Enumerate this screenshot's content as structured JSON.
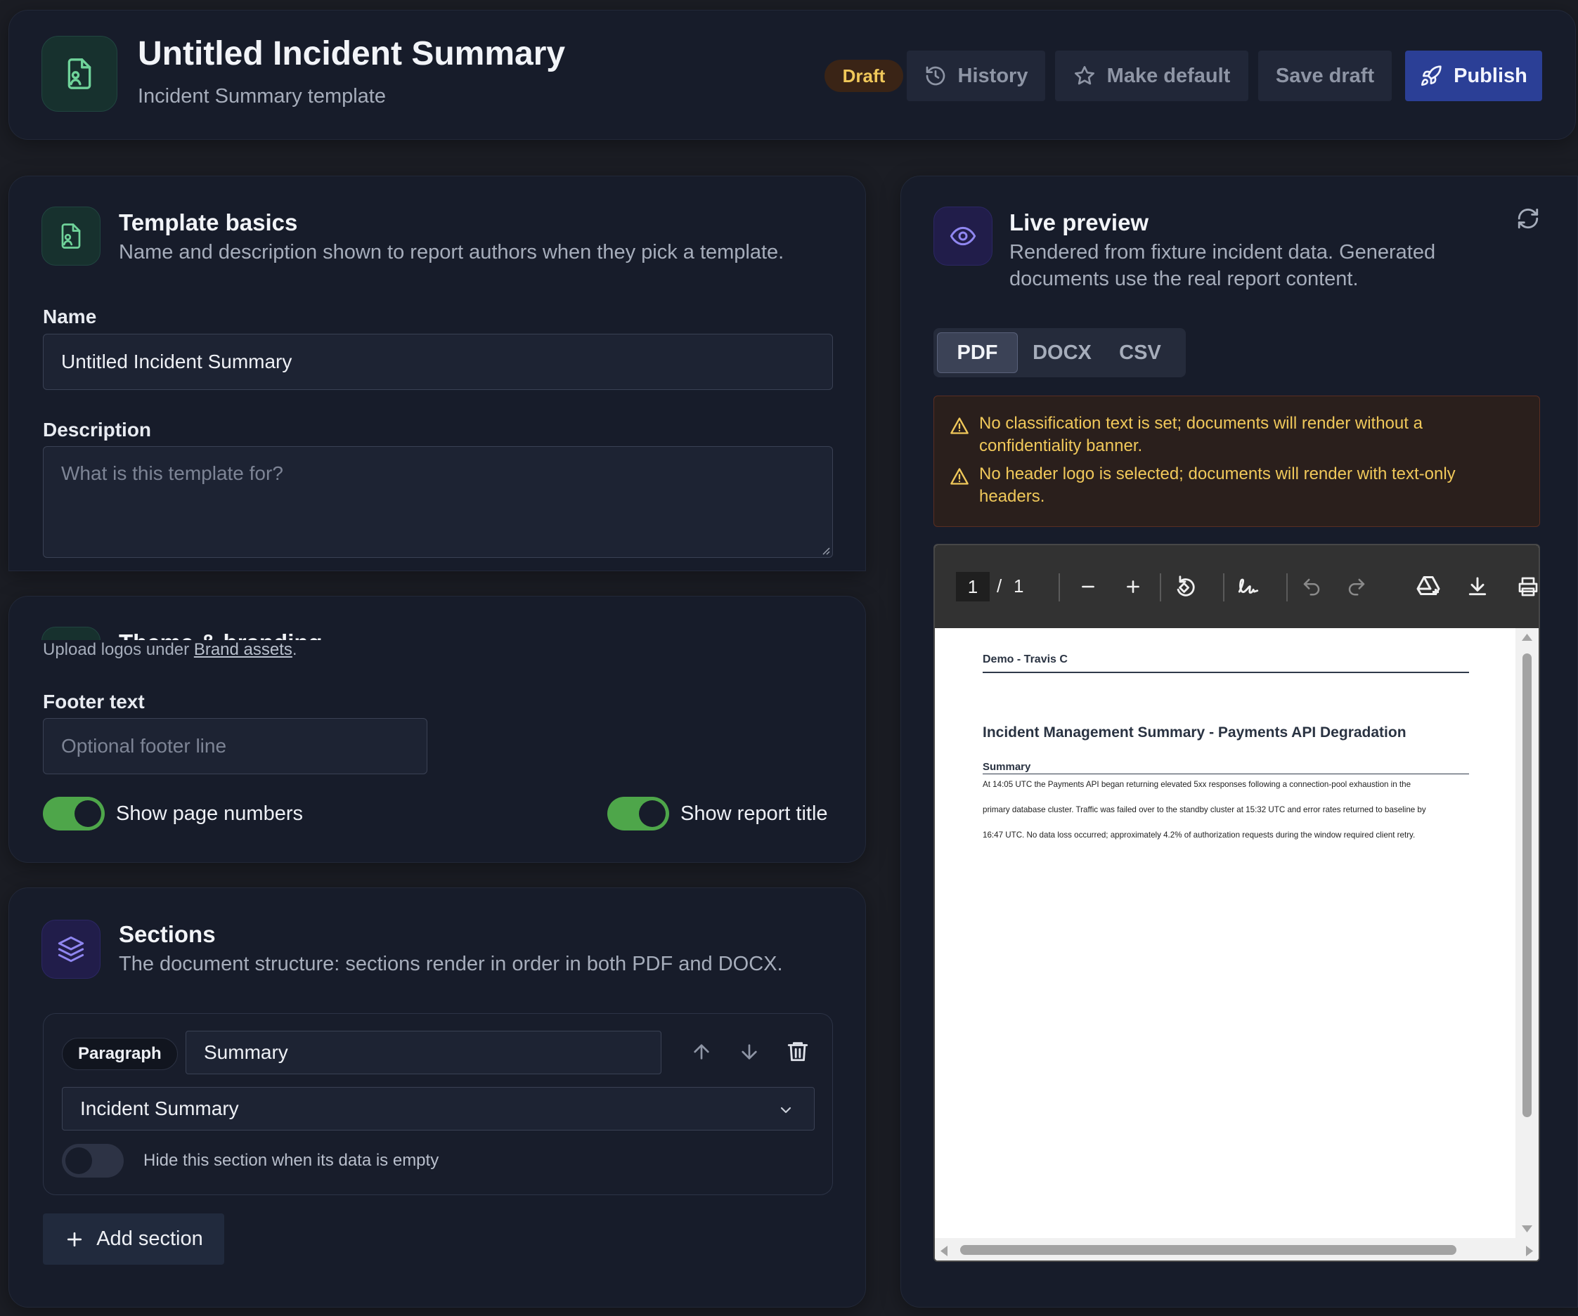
{
  "header": {
    "title": "Untitled Incident Summary",
    "subtitle": "Incident Summary template",
    "status_badge": "Draft",
    "history_label": "History",
    "make_default_label": "Make default",
    "save_draft_label": "Save draft",
    "publish_label": "Publish"
  },
  "basics": {
    "title": "Template basics",
    "description": "Name and description shown to report authors when they pick a template.",
    "name_label": "Name",
    "name_value": "Untitled Incident Summary",
    "description_label": "Description",
    "description_placeholder": "What is this template for?"
  },
  "theme": {
    "title": "Theme & branding",
    "upload_note_prefix": "Upload logos under ",
    "upload_note_link": "Brand assets",
    "upload_note_suffix": ".",
    "footer_label": "Footer text",
    "footer_placeholder": "Optional footer line",
    "show_page_numbers_label": "Show page numbers",
    "show_page_numbers": true,
    "show_report_title_label": "Show report title",
    "show_report_title": true
  },
  "sections": {
    "title": "Sections",
    "description": "The document structure: sections render in order in both PDF and DOCX.",
    "items": [
      {
        "type_badge": "Paragraph",
        "name": "Summary",
        "source": "Incident Summary",
        "hide_when_empty_label": "Hide this section when its data is empty",
        "hide_when_empty": false
      }
    ],
    "add_label": "Add section"
  },
  "preview": {
    "title": "Live preview",
    "description_line1": "Rendered from fixture incident data. Generated",
    "description_line2": "documents use the real report content.",
    "tabs": [
      "PDF",
      "DOCX",
      "CSV"
    ],
    "active_tab": "PDF",
    "warnings": [
      {
        "line1": "No classification text is set; documents will render without a",
        "line2": "confidentiality banner."
      },
      {
        "line1": "No header logo is selected; documents will render with text-only",
        "line2": "headers."
      }
    ],
    "viewer": {
      "page_current": "1",
      "page_sep": "/",
      "page_total": "1"
    },
    "document": {
      "header": "Demo - Travis C",
      "title": "Incident Management Summary - Payments API Degradation",
      "section_heading": "Summary",
      "body_lines": [
        "At 14:05 UTC the Payments API began returning elevated 5xx responses following a connection-pool exhaustion in the",
        "primary database cluster. Traffic was failed over to the standby cluster at 15:32 UTC and error rates returned to baseline by",
        "16:47 UTC. No data loss occurred; approximately 4.2% of authorization requests during the window required client retry."
      ]
    }
  },
  "colors": {
    "accent": "#2b3f96",
    "toggle_on": "#4ea64a",
    "warning_text": "#f0c85a",
    "warning_bg": "#2a1f1c",
    "draft_badge_bg": "#3a2416"
  }
}
